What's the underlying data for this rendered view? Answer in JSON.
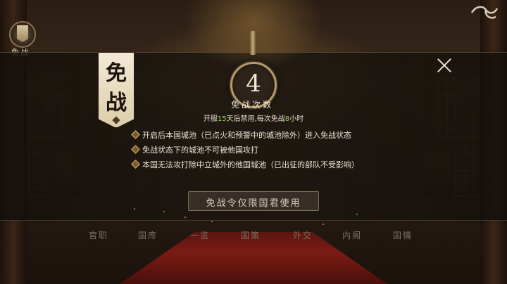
{
  "top_left_icon": {
    "label": "免战"
  },
  "modal": {
    "title": [
      "免",
      "战"
    ],
    "close_icon": "close-icon",
    "count": {
      "value": "4",
      "label": "免战次数",
      "note_prefix": "开服",
      "note_days": "15",
      "note_mid": "天后禁用,每次免战",
      "note_hours": "8",
      "note_suffix": "小时",
      "highlight_color": "#8fd45a"
    },
    "rules": [
      "开启后本国城池（已点火和预警中的城池除外）进入免战状态",
      "免战状态下的城池不可被他国攻打",
      "本国无法攻打除中立城外的他国城池（已出征的部队不受影响）"
    ],
    "notice": "免战令仅限国君使用"
  },
  "bottom_menu": [
    "官职",
    "国库",
    "一览",
    "国策",
    "外交",
    "内阁",
    "国情"
  ]
}
